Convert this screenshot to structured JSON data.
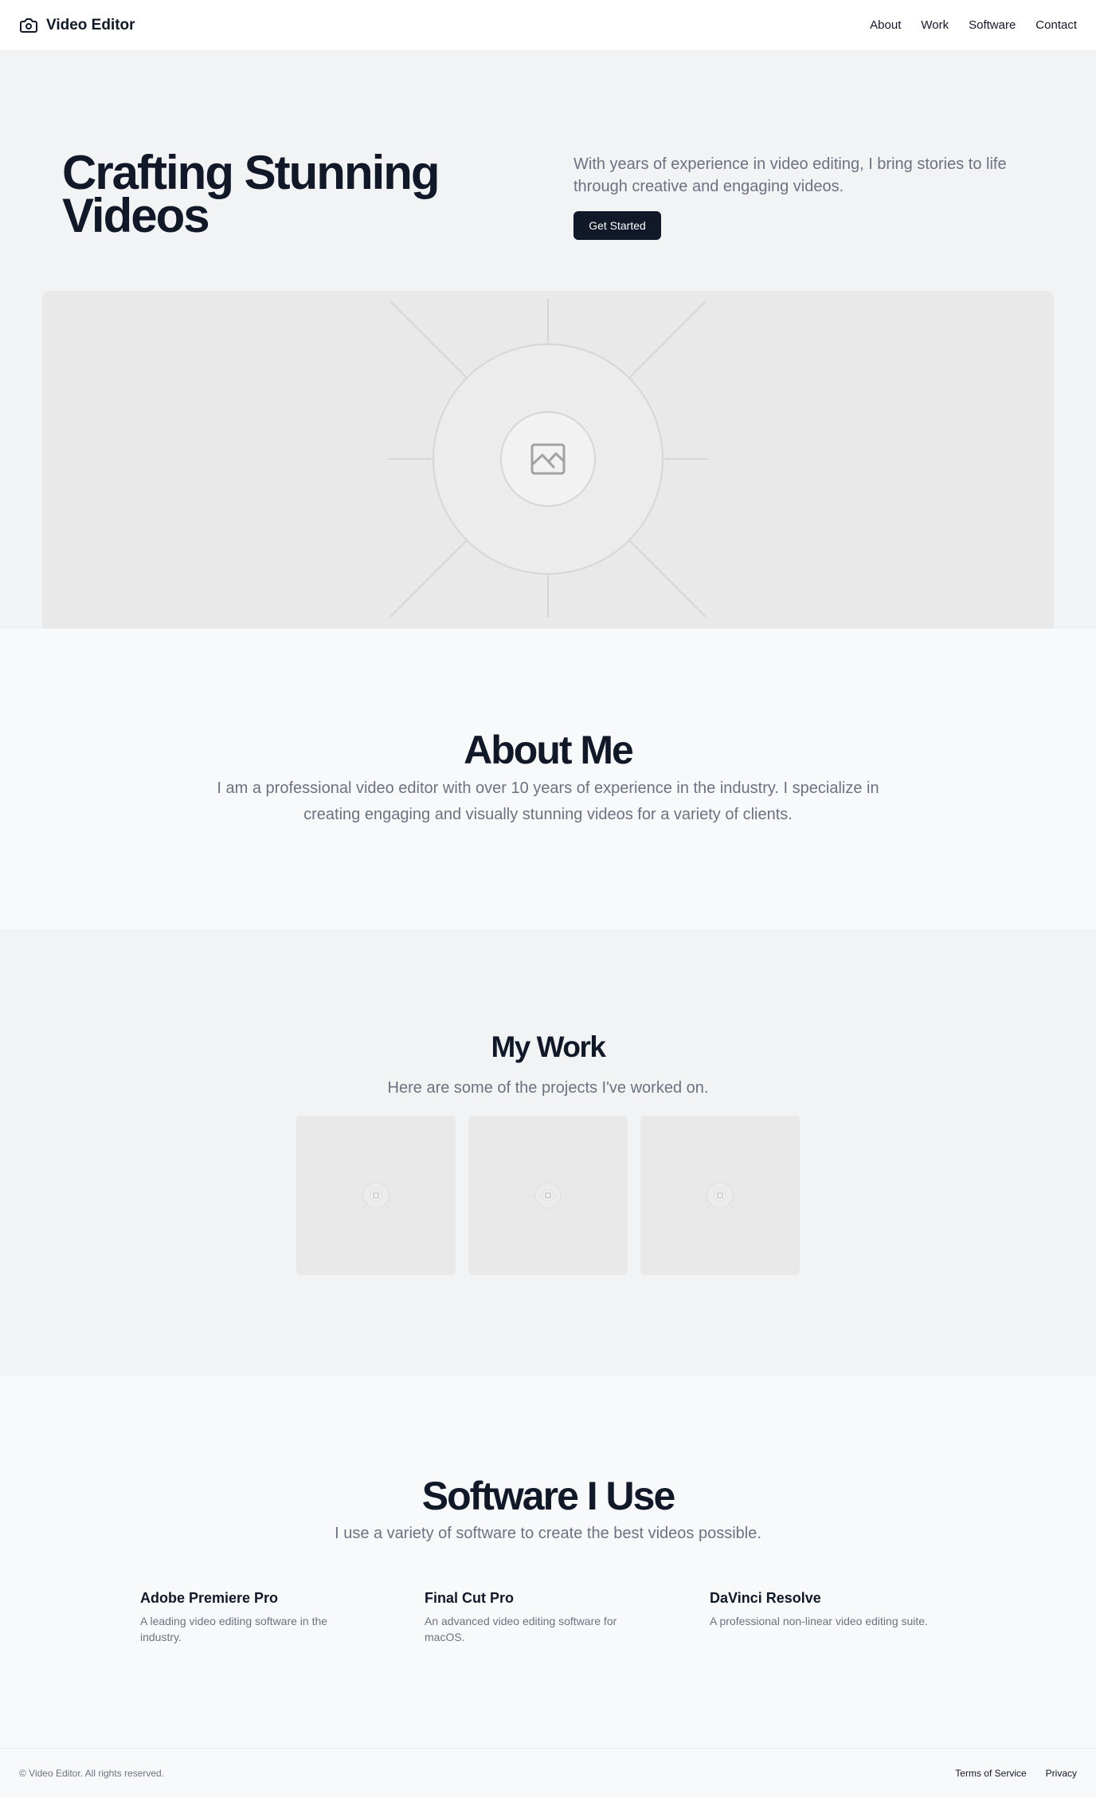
{
  "header": {
    "brand": "Video Editor",
    "brand_icon": "camera-icon",
    "nav": [
      {
        "label": "About"
      },
      {
        "label": "Work"
      },
      {
        "label": "Software"
      },
      {
        "label": "Contact"
      }
    ]
  },
  "hero": {
    "title": "Crafting Stunning Videos",
    "text": "With years of experience in video editing, I bring stories to life through creative and engaging videos.",
    "cta": "Get Started",
    "image_icon": "image-placeholder-icon"
  },
  "about": {
    "title": "About Me",
    "text": "I am a professional video editor with over 10 years of experience in the industry. I specialize in creating engaging and visually stunning videos for a variety of clients."
  },
  "work": {
    "title": "My Work",
    "subtitle": "Here are some of the projects I've worked on.",
    "projects": [
      {
        "icon": "image-placeholder-icon"
      },
      {
        "icon": "image-placeholder-icon"
      },
      {
        "icon": "image-placeholder-icon"
      }
    ]
  },
  "software": {
    "title": "Software I Use",
    "subtitle": "I use a variety of software to create the best videos possible.",
    "items": [
      {
        "name": "Adobe Premiere Pro",
        "desc": "A leading video editing software in the industry."
      },
      {
        "name": "Final Cut Pro",
        "desc": "An advanced video editing software for macOS."
      },
      {
        "name": "DaVinci Resolve",
        "desc": "A professional non-linear video editing suite."
      }
    ]
  },
  "footer": {
    "copyright": "© Video Editor. All rights reserved.",
    "links": [
      {
        "label": "Terms of Service"
      },
      {
        "label": "Privacy"
      }
    ]
  },
  "colors": {
    "primary": "#111827",
    "muted_text": "#6b7280",
    "hero_bg": "#f2f3f5",
    "placeholder_bg": "#e9e9ea"
  }
}
